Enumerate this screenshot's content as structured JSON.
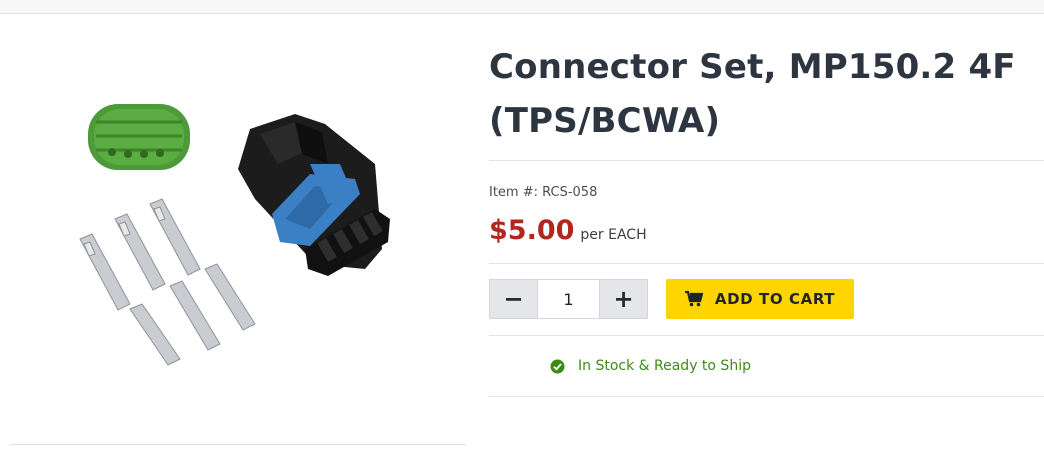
{
  "product": {
    "title_line1": "Connector Set, MP150.2 4F",
    "title_line2": "(TPS/BCWA)",
    "item_number": "Item #: RCS-058",
    "price": "$5.00",
    "unit": "per EACH",
    "image_icon": "product-photo"
  },
  "purchase": {
    "decrement_label": "−",
    "increment_label": "+",
    "quantity": "1",
    "add_to_cart_label": "ADD TO CART",
    "cart_icon": "cart-icon"
  },
  "stock": {
    "label": "In Stock & Ready to Ship",
    "icon": "check-circle-icon"
  },
  "colors": {
    "price": "#b3261e",
    "button": "#ffd400",
    "stock": "#3d8b16"
  }
}
